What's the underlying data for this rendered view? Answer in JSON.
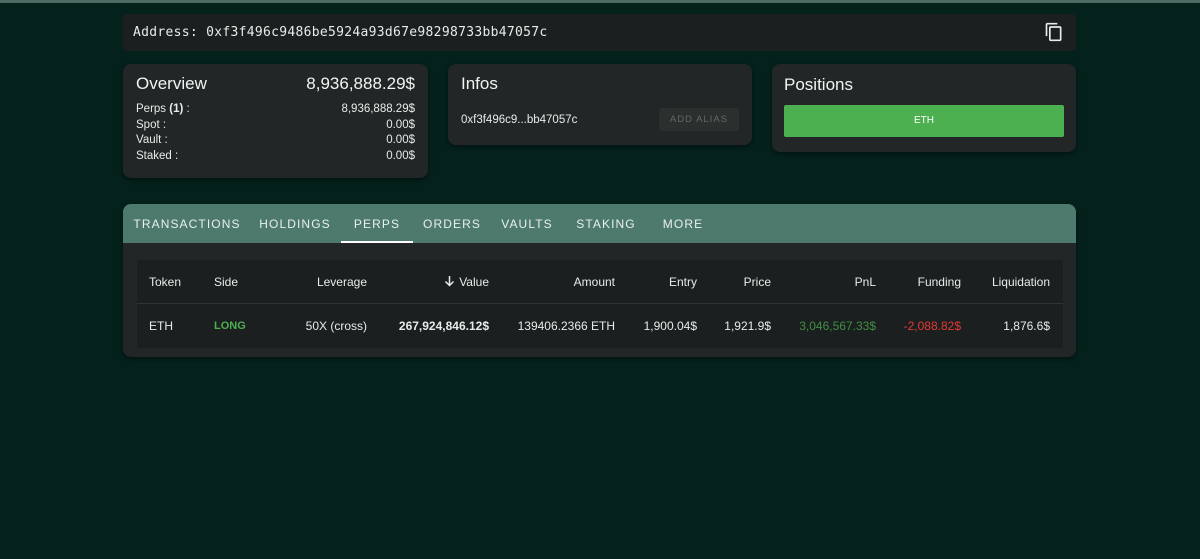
{
  "address_bar": {
    "label": "Address: 0xf3f496c9486be5924a93d67e98298733bb47057c"
  },
  "overview": {
    "title": "Overview",
    "total": "8,936,888.29$",
    "rows": [
      {
        "label": "Perps",
        "count": "(1)",
        "suffix": " :",
        "value": "8,936,888.29$"
      },
      {
        "label": "Spot :",
        "value": "0.00$"
      },
      {
        "label": "Vault :",
        "value": "0.00$"
      },
      {
        "label": "Staked :",
        "value": "0.00$"
      }
    ]
  },
  "infos": {
    "title": "Infos",
    "short_address": "0xf3f496c9...bb47057c",
    "alias_button": "ADD ALIAS"
  },
  "positions": {
    "title": "Positions",
    "token_button": "ETH"
  },
  "tabs": [
    "TRANSACTIONS",
    "HOLDINGS",
    "PERPS",
    "ORDERS",
    "VAULTS",
    "STAKING",
    "MORE"
  ],
  "active_tab": "PERPS",
  "table": {
    "headers": [
      "Token",
      "Side",
      "Leverage",
      "Value",
      "Amount",
      "Entry",
      "Price",
      "PnL",
      "Funding",
      "Liquidation"
    ],
    "rows": [
      {
        "token": "ETH",
        "side": "LONG",
        "leverage": "50X (cross)",
        "value": "267,924,846.12$",
        "amount": "139406.2366 ETH",
        "entry": "1,900.04$",
        "price": "1,921.9$",
        "pnl": "3,046,567.33$",
        "funding": "-2,088.82$",
        "liquidation": "1,876.6$"
      }
    ]
  },
  "colors": {
    "background": "#04211c",
    "tab_bar": "#4d7a6c",
    "long": "#4caf50",
    "funding_negative": "#e53935",
    "eth_button": "#4caf50"
  },
  "icons": {
    "copy": "copy-icon",
    "sort": "arrow-down-icon"
  }
}
